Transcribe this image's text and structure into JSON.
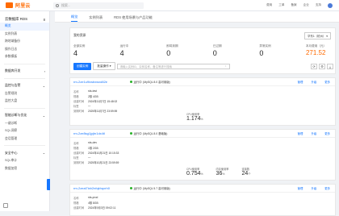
{
  "topbar": {
    "logo_text": "阿里云",
    "search_placeholder": "搜索...",
    "links": [
      "费用",
      "工单",
      "备案",
      "企业",
      "支持"
    ]
  },
  "sidebar": {
    "title": "云数据库 RDS",
    "items": [
      {
        "label": "概览",
        "active": true
      },
      {
        "label": "实例列表",
        "active": false
      },
      {
        "label": "跨地域备份",
        "active": false
      },
      {
        "label": "操作日志",
        "active": false
      },
      {
        "label": "参数模板",
        "active": false
      }
    ],
    "groups": [
      {
        "label": "数据库开发"
      },
      {
        "label": "监控与告警",
        "items": [
          "告警规则",
          "监控大盘"
        ]
      },
      {
        "label": "智能诊断与优化",
        "items": [
          "一键诊断",
          "SQL洞察",
          "会话管理"
        ]
      },
      {
        "label": "安全中心",
        "items": [
          "SQL审计",
          "数据加密"
        ]
      }
    ]
  },
  "tabs": [
    "概览",
    "实例列表",
    "RDS 使用场景与产品功能"
  ],
  "stats": {
    "title": "我的资源",
    "region": "华东1（杭州）",
    "items": [
      {
        "label": "全部实例",
        "value": "4"
      },
      {
        "label": "运行中",
        "value": "4"
      },
      {
        "label": "即将到期",
        "value": "0"
      },
      {
        "label": "已过期",
        "value": "0"
      },
      {
        "label": "异常实例",
        "value": "0"
      },
      {
        "label": "本月费用（元）",
        "value": "271.52"
      }
    ]
  },
  "toolbar": {
    "create_label": "创建实例",
    "batch_label": "批量操作",
    "filter_placeholder": "请输入实例ID、实例名称、备注等进行搜索",
    "refresh": "⟳",
    "settings": "⚙",
    "download": "⤓"
  },
  "cards": [
    {
      "id": "rm-2ze1u9ixsbxwxd82e",
      "status": "运行中",
      "spec": "(MySQL 8.0 高可用版)",
      "actions": [
        "管理",
        "升级",
        "更多"
      ],
      "fields": [
        {
          "k": "名称",
          "v": "rds-test"
        },
        {
          "k": "规格",
          "v": "2核 4GB"
        },
        {
          "k": "创建时间",
          "v": "2024年11月7日 15:48:02"
        },
        {
          "k": "标签",
          "v": "—"
        },
        {
          "k": "到期时间",
          "v": "2025年11月7日 23:59:59"
        }
      ],
      "metrics": [
        {
          "label": "CPU使用率",
          "value": "1.174",
          "unit": "%"
        }
      ]
    },
    {
      "id": "rm-2ze8sg1jyjtn1dx4tl",
      "status": "运行中",
      "spec": "(MySQL 8.0 基础版)",
      "actions": [
        "管理",
        "升级",
        "更多"
      ],
      "fields": [
        {
          "k": "名称",
          "v": "rds-dev"
        },
        {
          "k": "规格",
          "v": "1核 2GB"
        },
        {
          "k": "创建时间",
          "v": "2024年10月21日 10:15:33"
        },
        {
          "k": "标签",
          "v": "—"
        },
        {
          "k": "到期时间",
          "v": "2025年10月21日 23:59:59"
        }
      ],
      "metrics": [
        {
          "label": "CPU使用率",
          "value": "0.754",
          "unit": "%"
        },
        {
          "label": "内存使用率",
          "value": "36",
          "unit": "%"
        },
        {
          "label": "连接数",
          "value": "24",
          "unit": "个"
        }
      ]
    },
    {
      "id": "rm-2zeal7ixb2nfqkhqxrh0",
      "status": "运行中",
      "spec": "(MySQL 5.7 高可用版)",
      "actions": [
        "管理",
        "升级",
        "更多"
      ],
      "fields": [
        {
          "k": "名称",
          "v": "rds-prod"
        },
        {
          "k": "规格",
          "v": "4核 8GB"
        },
        {
          "k": "创建时间",
          "v": "2024年9月3日 09:02:11"
        }
      ],
      "metrics": []
    }
  ]
}
